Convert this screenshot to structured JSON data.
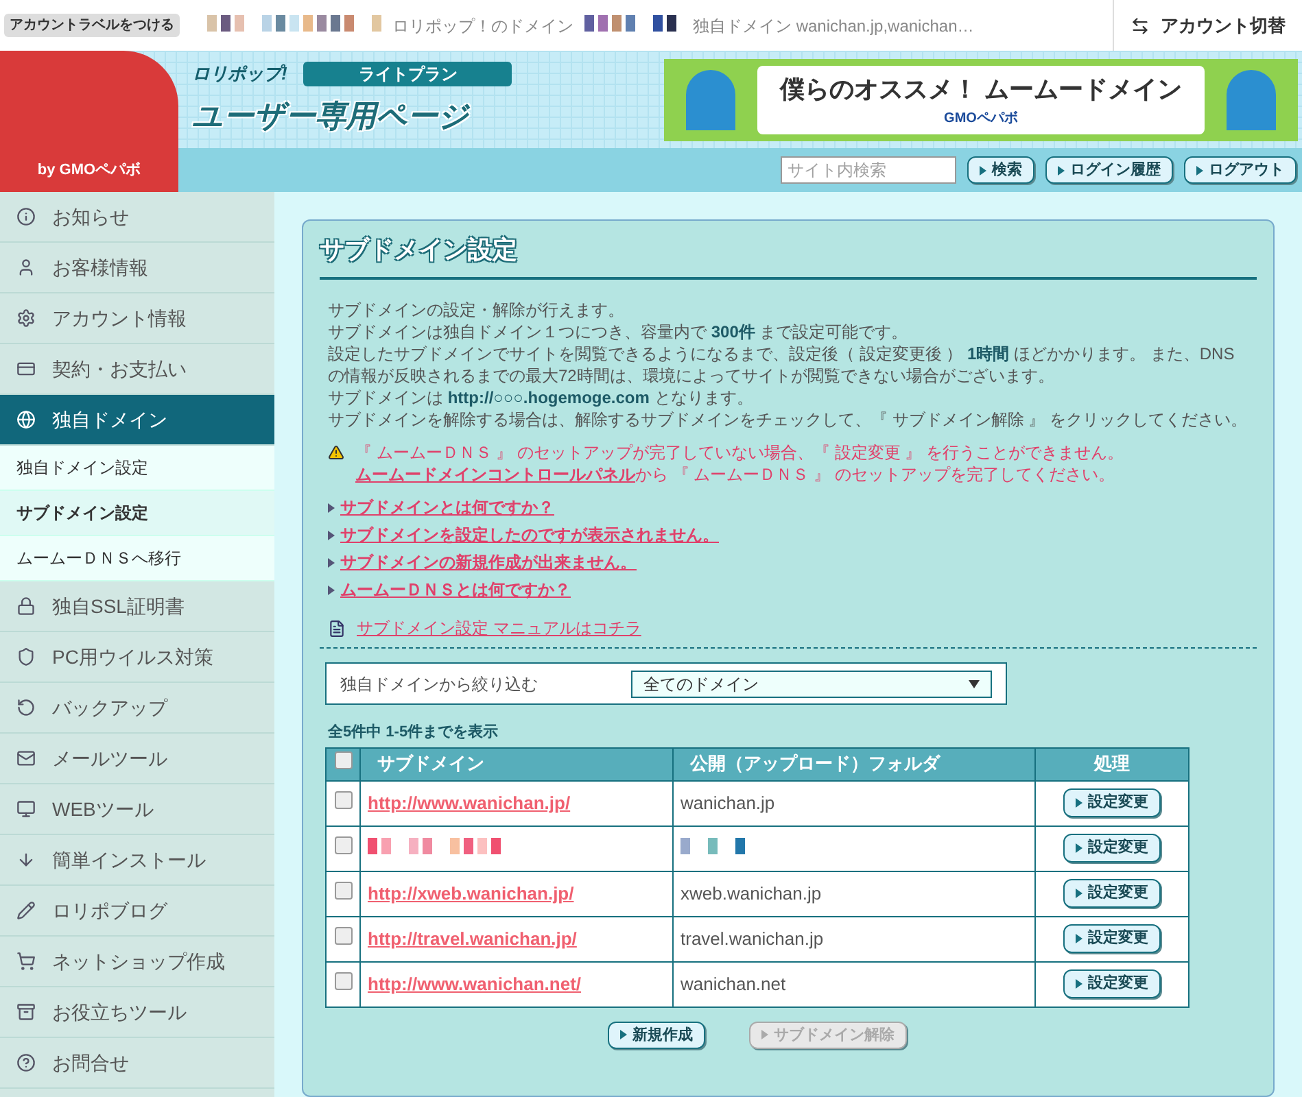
{
  "top_bar": {
    "label_button": "アカウントラベルをつける",
    "account_domain": "ロリポップ！のドメイン",
    "own_domain": "独自ドメイン wanichan.jp,wanichan…",
    "switch_button": "アカウント切替"
  },
  "header": {
    "brand": "ロリポップ!",
    "plan": "ライトプラン",
    "title": "ユーザー専用ページ",
    "by": "by GMOペパボ",
    "banner": {
      "text": "僕らのオススメ！ ムームードメイン",
      "company": "GMOペパボ"
    }
  },
  "nav": {
    "search": {
      "placeholder": "サイト内検索"
    },
    "buttons": [
      "検索",
      "ログイン履歴",
      "ログアウト"
    ]
  },
  "sidebar": {
    "items": [
      {
        "kind": "main",
        "label": "お知らせ",
        "selected": false
      },
      {
        "kind": "main",
        "label": "お客様情報",
        "selected": false
      },
      {
        "kind": "main",
        "label": "アカウント情報",
        "selected": false
      },
      {
        "kind": "main",
        "label": "契約・お支払い",
        "selected": false
      },
      {
        "kind": "main",
        "label": "独自ドメイン",
        "selected": true
      },
      {
        "kind": "sub",
        "label": "独自ドメイン設定",
        "selected": false
      },
      {
        "kind": "sub",
        "label": "サブドメイン設定",
        "selected": true
      },
      {
        "kind": "sub",
        "label": "ムームーＤＮＳへ移行",
        "selected": false
      },
      {
        "kind": "main",
        "label": "独自SSL証明書",
        "selected": false
      },
      {
        "kind": "main",
        "label": "PC用ウイルス対策",
        "selected": false
      },
      {
        "kind": "main",
        "label": "バックアップ",
        "selected": false
      },
      {
        "kind": "main",
        "label": "メールツール",
        "selected": false
      },
      {
        "kind": "main",
        "label": "WEBツール",
        "selected": false
      },
      {
        "kind": "main",
        "label": "簡単インストール",
        "selected": false
      },
      {
        "kind": "main",
        "label": "ロリポブログ",
        "selected": false
      },
      {
        "kind": "main",
        "label": "ネットショップ作成",
        "selected": false
      },
      {
        "kind": "main",
        "label": "お役立ちツール",
        "selected": false
      },
      {
        "kind": "main",
        "label": "お問合せ",
        "selected": false
      }
    ]
  },
  "panel": {
    "title": "サブドメイン設定",
    "intro": [
      "サブドメインの設定・解除が行えます。",
      "サブドメインは独自ドメイン１つにつき、容量内で **300件** まで設定可能です。",
      "設定したサブドメインでサイトを閲覧できるようになるまで、設定後（ 設定変更後 ） **1時間** ほどかかります。 また、DNSの情報が反映されるまでの最大72時間は、環境によってサイトが閲覧できない場合がございます。",
      "サブドメインは **http://○○○.hogemoge.com** となります。",
      "サブドメインを解除する場合は、解除するサブドメインをチェックして、『 サブドメイン解除 』 をクリックしてください。"
    ],
    "warning": {
      "line1": "『 ムームーＤＮＳ 』 のセットアップが完了していない場合、『 設定変更 』 を行うことができません。",
      "link": "ムームードメインコントロールパネル",
      "line2": "から 『 ムームーＤＮＳ 』 のセットアップを完了してください。"
    },
    "faq_links": [
      "サブドメインとは何ですか？",
      "サブドメインを設定したのですが表示されません。",
      "サブドメインの新規作成が出来ません。",
      "ムームーＤＮＳとは何ですか？"
    ],
    "manual_link": "サブドメイン設定 マニュアルはコチラ",
    "filter": {
      "label": "独自ドメインから絞り込む",
      "value": "全てのドメイン"
    },
    "count": "全5件中 1-5件までを表示",
    "table": {
      "all_checked": false,
      "columns": [
        "サブドメイン",
        "公開（アップロード）フォルダ",
        "処理"
      ],
      "rows": [
        {
          "kind": "normal",
          "checked": false,
          "subdomain": "http://www.wanichan.jp/",
          "folder": "wanichan.jp",
          "action": "設定変更"
        },
        {
          "kind": "redacted",
          "checked": false,
          "action": "設定変更"
        },
        {
          "kind": "normal",
          "checked": false,
          "subdomain": "http://xweb.wanichan.jp/",
          "folder": "xweb.wanichan.jp",
          "action": "設定変更"
        },
        {
          "kind": "normal",
          "checked": false,
          "subdomain": "http://travel.wanichan.jp/",
          "folder": "travel.wanichan.jp",
          "action": "設定変更"
        },
        {
          "kind": "normal",
          "checked": false,
          "subdomain": "http://www.wanichan.net/",
          "folder": "wanichan.net",
          "action": "設定変更"
        }
      ]
    },
    "actions": [
      {
        "label": "新規作成",
        "disabled": false
      },
      {
        "label": "サブドメイン解除",
        "disabled": true
      }
    ]
  }
}
